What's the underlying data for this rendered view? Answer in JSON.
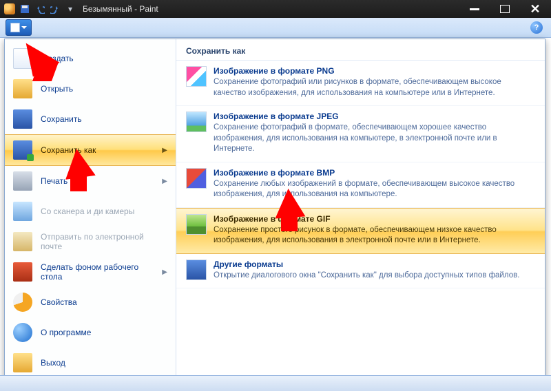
{
  "titlebar": {
    "title": "Безымянный - Paint"
  },
  "left_menu": {
    "items": [
      {
        "label": "Создать"
      },
      {
        "label": "Открыть"
      },
      {
        "label": "Сохранить"
      },
      {
        "label": "Сохранить как"
      },
      {
        "label": "Печать"
      },
      {
        "label": "Со сканера и ди камеры"
      },
      {
        "label": "Отправить по электронной почте"
      },
      {
        "label": "Сделать фоном рабочего стола"
      },
      {
        "label": "Свойства"
      },
      {
        "label": "О программе"
      },
      {
        "label": "Выход"
      }
    ]
  },
  "right_panel": {
    "header": "Сохранить как",
    "items": [
      {
        "title": "Изображение в формате PNG",
        "desc": "Сохранение фотографий или рисунков в формате, обеспечивающем высокое качество изображения, для использования на компьютере или в Интернете."
      },
      {
        "title": "Изображение в формате JPEG",
        "desc": "Сохранение фотографий в формате, обеспечивающем хорошее качество изображения, для использования на компьютере, в электронной почте или в Интернете."
      },
      {
        "title": "Изображение в формате BMP",
        "desc": "Сохранение любых изображений в формате, обеспечивающем высокое качество изображения, для использования на компьютере."
      },
      {
        "title": "Изображение в формате GIF",
        "desc": "Сохранение простого рисунок в формате, обеспечивающем низкое качество изображения, для использования в электронной почте или в Интернете."
      },
      {
        "title": "Другие форматы",
        "desc": "Открытие диалогового окна \"Сохранить как\" для выбора доступных типов файлов."
      }
    ]
  }
}
